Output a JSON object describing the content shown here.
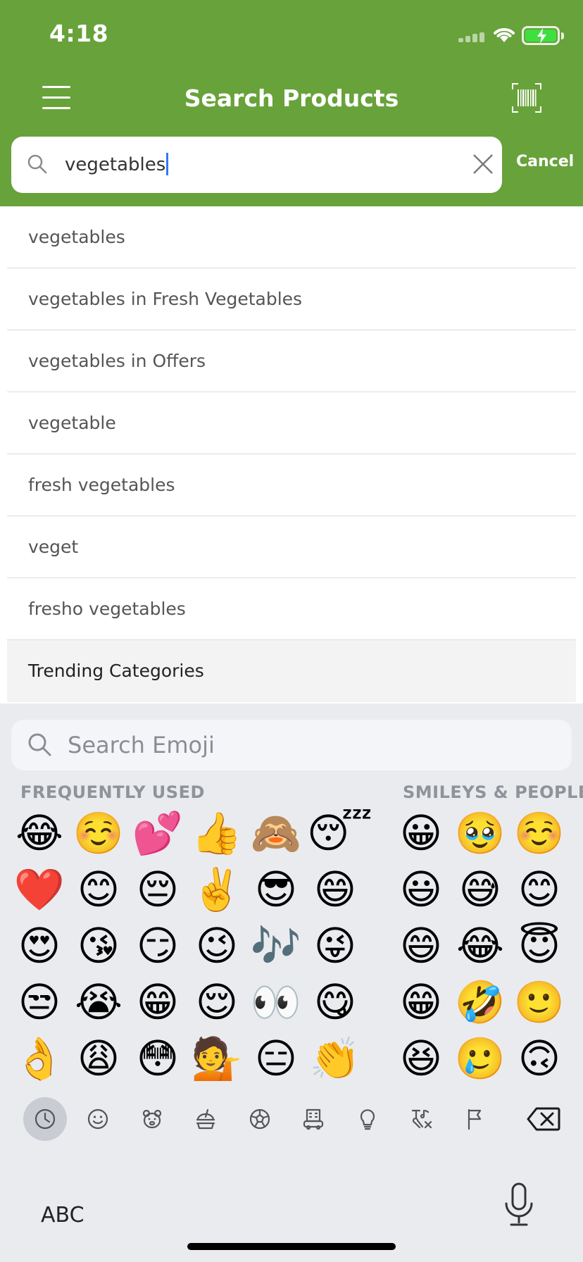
{
  "status_bar": {
    "time": "4:18"
  },
  "header": {
    "title": "Search Products",
    "search": {
      "value": "vegetables"
    },
    "cancel_label": "Cancel"
  },
  "suggestions": [
    "vegetables",
    "vegetables in Fresh Vegetables",
    "vegetables in Offers",
    "vegetable",
    "fresh vegetables",
    "veget",
    "fresho vegetables"
  ],
  "trending_label": "Trending Categories",
  "keyboard": {
    "search_placeholder": "Search Emoji",
    "sections": {
      "frequent": "FREQUENTLY USED",
      "smileys": "SMILEYS & PEOPLE"
    },
    "frequent_rows": [
      [
        "😂",
        "☺️",
        "💕",
        "👍",
        "🙈",
        "😴"
      ],
      [
        "❤️",
        "😊",
        "😔",
        "✌️",
        "😎",
        "😄"
      ],
      [
        "😍",
        "😘",
        "😏",
        "😉",
        "🎶",
        "😜"
      ],
      [
        "😒",
        "😭",
        "😁",
        "😌",
        "👀",
        "😋"
      ],
      [
        "👌",
        "😩",
        "😳",
        "💁",
        "😑",
        "👏"
      ]
    ],
    "smiley_rows": [
      [
        "😀",
        "🥹",
        "☺️"
      ],
      [
        "😃",
        "😅",
        "😊"
      ],
      [
        "😄",
        "😂",
        "😇"
      ],
      [
        "😁",
        "🤣",
        "🙂"
      ],
      [
        "😆",
        "🥲",
        "🙃"
      ]
    ],
    "categories": [
      "recent-icon",
      "smiley-icon",
      "animal-icon",
      "food-icon",
      "ball-icon",
      "building-icon",
      "lightbulb-icon",
      "symbols-icon",
      "flag-icon"
    ],
    "abc_label": "ABC"
  },
  "colors": {
    "header_bg": "#68a23a",
    "caret": "#3478f6",
    "battery_fill": "#3ee040"
  }
}
